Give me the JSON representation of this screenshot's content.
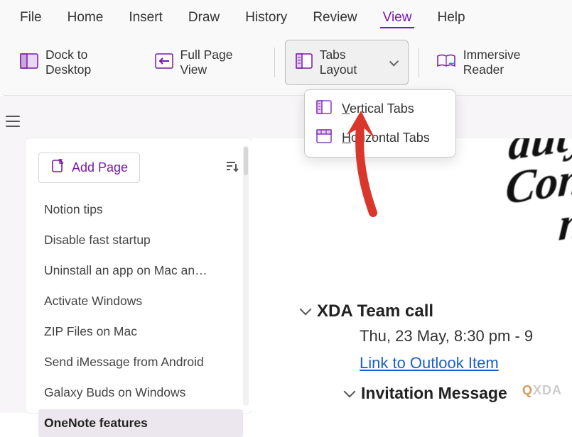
{
  "menu": {
    "items": [
      "File",
      "Home",
      "Insert",
      "Draw",
      "History",
      "Review",
      "View",
      "Help"
    ],
    "active_index": 6
  },
  "toolbar": {
    "dock_label": "Dock to Desktop",
    "fullpage_label": "Full Page View",
    "tabslayout_label": "Tabs Layout",
    "immersive_label": "Immersive Reader"
  },
  "tabslayout_dropdown": {
    "items": [
      {
        "label_prefix": "V",
        "label_rest": "ertical Tabs"
      },
      {
        "label_prefix": "H",
        "label_rest": "orizontal Tabs"
      }
    ]
  },
  "sidebar": {
    "add_page_label": "Add Page",
    "pages": [
      "Notion tips",
      "Disable fast startup",
      "Uninstall an app on Mac an…",
      "Activate Windows",
      "ZIP Files on Mac",
      "Send iMessage from Android",
      "Galaxy Buds on Windows",
      "OneNote features"
    ],
    "selected_index": 7
  },
  "content": {
    "bg_lines": [
      "duty",
      "Conf",
      "nc"
    ],
    "heading1": "XDA Team call",
    "datetime": "Thu, 23 May, 8:30 pm - 9",
    "link_text": "Link to Outlook Item",
    "heading2": "Invitation Message"
  },
  "watermark": {
    "prefix": "Q",
    "rest": "XDA"
  },
  "colors": {
    "accent": "#7719aa",
    "link": "#1a5fc7",
    "arrow": "#d9372b"
  }
}
